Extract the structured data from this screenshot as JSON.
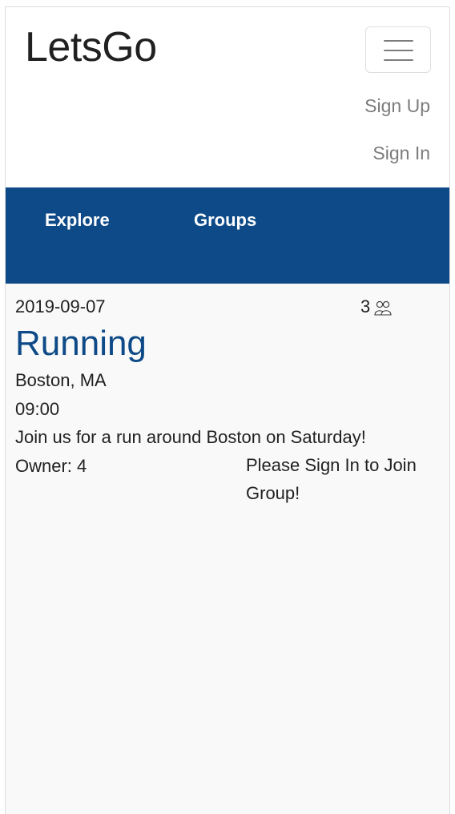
{
  "navbar": {
    "brand": "LetsGo",
    "sign_up": "Sign Up",
    "sign_in": "Sign In"
  },
  "tabs": [
    {
      "label": "Explore"
    },
    {
      "label": "Groups"
    }
  ],
  "group": {
    "date": "2019-09-07",
    "member_count": "3",
    "title": "Running",
    "location": "Boston, MA",
    "time": "09:00",
    "description": "Join us for a run around Boston on Saturday!",
    "owner": "Owner: 4",
    "join_message": "Please Sign In to Join Group!"
  },
  "colors": {
    "primary": "#0e4a87",
    "background": "#f9f9f9"
  },
  "icons": {
    "menu": "hamburger-icon",
    "members": "people-icon"
  }
}
